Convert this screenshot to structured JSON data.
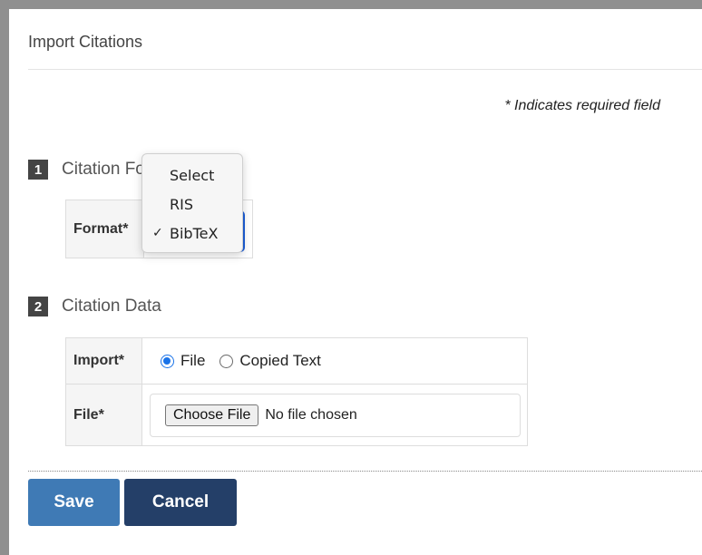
{
  "panel": {
    "title": "Import Citations",
    "required_note": "* Indicates required field"
  },
  "steps": [
    {
      "number": "1",
      "label": "Citation Format"
    },
    {
      "number": "2",
      "label": "Citation Data"
    }
  ],
  "format_field": {
    "label": "Format*",
    "selected": "BibTeX",
    "options": [
      "Select",
      "RIS",
      "BibTeX"
    ],
    "check_mark": "✓"
  },
  "import_field": {
    "label": "Import*",
    "options": [
      {
        "label": "File",
        "checked": true
      },
      {
        "label": "Copied Text",
        "checked": false
      }
    ]
  },
  "file_field": {
    "label": "File*",
    "button_label": "Choose File",
    "status": "No file chosen"
  },
  "actions": {
    "save_label": "Save",
    "cancel_label": "Cancel"
  },
  "colors": {
    "save": "#3f7ab5",
    "cancel": "#243f68",
    "focus": "#1d5fd8",
    "radio_checked": "#1a73e8"
  }
}
